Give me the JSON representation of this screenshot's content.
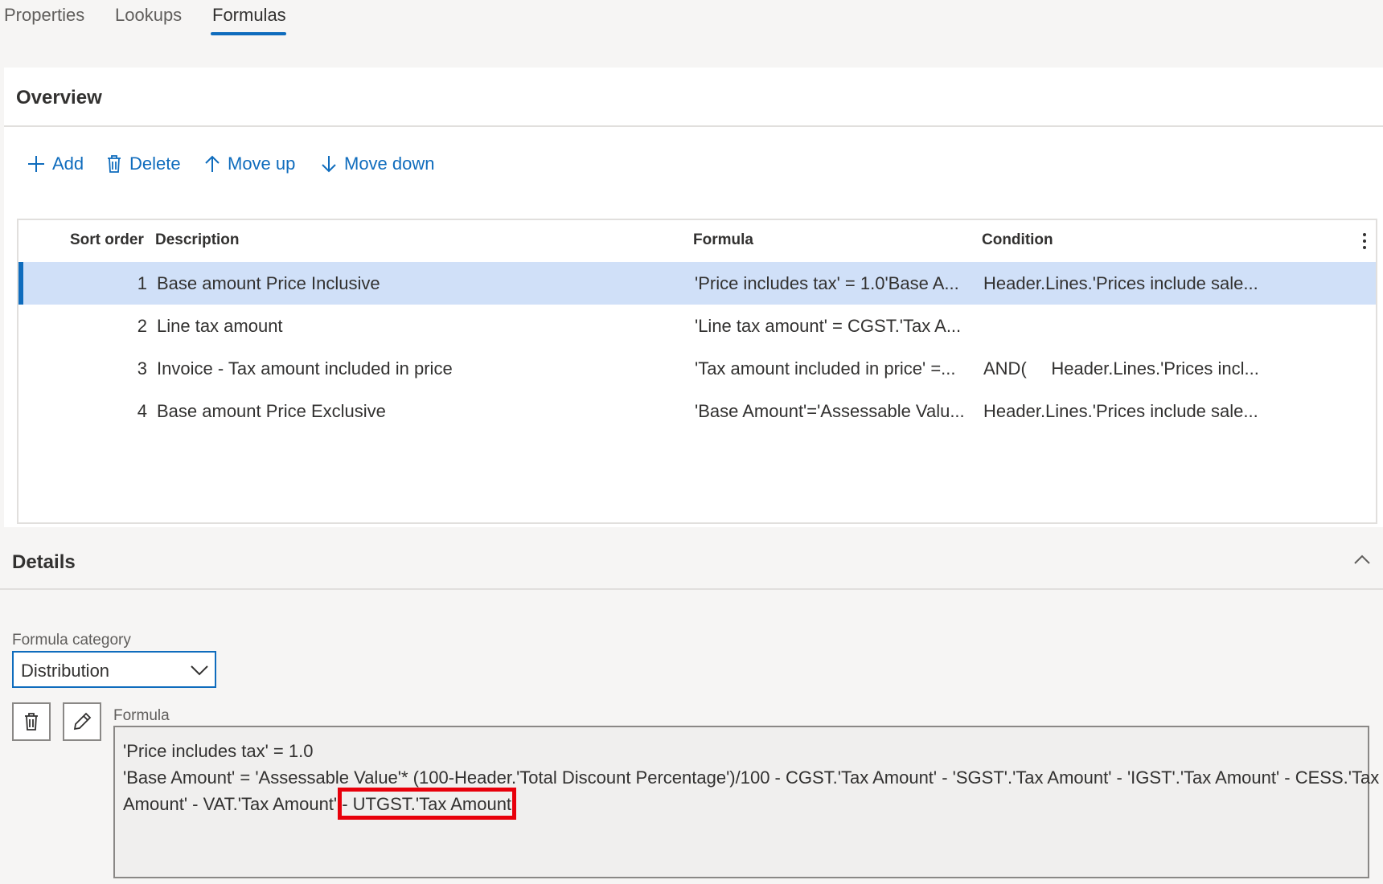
{
  "tabs": [
    {
      "label": "Properties"
    },
    {
      "label": "Lookups"
    },
    {
      "label": "Formulas"
    }
  ],
  "overview": {
    "title": "Overview",
    "toolbar": {
      "add": "Add",
      "delete": "Delete",
      "move_up": "Move up",
      "move_down": "Move down"
    },
    "columns": {
      "sort_order": "Sort order",
      "description": "Description",
      "formula": "Formula",
      "condition": "Condition"
    },
    "rows": [
      {
        "sort": "1",
        "description": "Base amount Price Inclusive",
        "formula": "'Price includes tax' = 1.0'Base A...",
        "condition": "Header.Lines.'Prices include sale..."
      },
      {
        "sort": "2",
        "description": "Line tax amount",
        "formula": "'Line tax amount' = CGST.'Tax A...",
        "condition": ""
      },
      {
        "sort": "3",
        "description": "Invoice - Tax amount included in price",
        "formula": "'Tax amount included in price' =...",
        "condition": "AND(     Header.Lines.'Prices incl..."
      },
      {
        "sort": "4",
        "description": "Base amount Price Exclusive",
        "formula": "'Base Amount'='Assessable Valu...",
        "condition": "Header.Lines.'Prices include sale..."
      }
    ],
    "selected_row": 1
  },
  "details": {
    "title": "Details",
    "formula_category_label": "Formula category",
    "formula_category_value": "Distribution",
    "formula_label": "Formula",
    "formula_lines": [
      "'Price includes tax' = 1.0",
      "'Base Amount' = 'Assessable Value'* (100-Header.'Total Discount Percentage')/100 - CGST.'Tax Amount' - 'SGST'.'Tax Amount' - 'IGST'.'Tax Amount' - CESS.'Tax",
      "Amount' - VAT.'Tax Amount' - UTGST.'Tax Amount'"
    ]
  },
  "icons": {
    "add": "plus-icon",
    "delete": "trash-icon",
    "move_up": "arrow-up-icon",
    "move_down": "arrow-down-icon",
    "more": "more-vertical-icon",
    "collapse": "chevron-up-icon",
    "dropdown": "chevron-down-icon",
    "edit": "pencil-icon"
  },
  "colors": {
    "accent": "#0f6cbd",
    "selected_row": "#d0e0f8",
    "highlight": "#e8000b"
  }
}
